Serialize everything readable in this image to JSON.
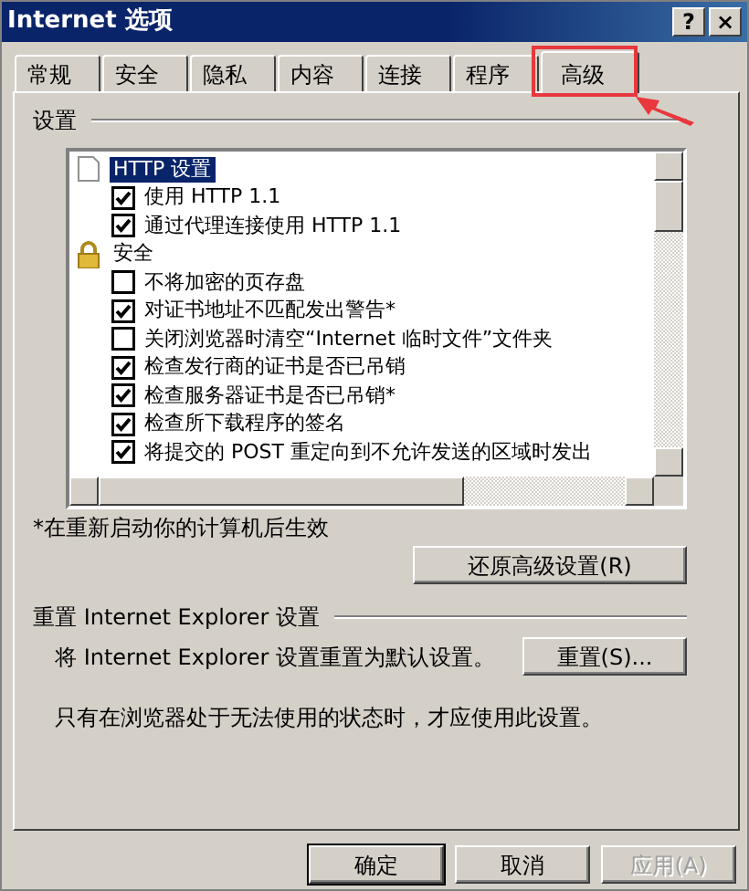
{
  "window": {
    "title": "Internet 选项",
    "buttons": [
      "?",
      "×"
    ]
  },
  "tabs": [
    {
      "label": "常规",
      "selected": false,
      "highlighted": false
    },
    {
      "label": "安全",
      "selected": false,
      "highlighted": false
    },
    {
      "label": "隐私",
      "selected": false,
      "highlighted": false
    },
    {
      "label": "内容",
      "selected": false,
      "highlighted": false
    },
    {
      "label": "连接",
      "selected": false,
      "highlighted": false
    },
    {
      "label": "程序",
      "selected": false,
      "highlighted": false
    },
    {
      "label": "高级",
      "selected": true,
      "highlighted": true
    }
  ],
  "settings": {
    "title": "设置",
    "categories": [
      {
        "label": "HTTP 设置",
        "kind": "document",
        "selected": true,
        "children": [
          {
            "label": "使用 HTTP 1.1",
            "checked": true
          },
          {
            "label": "通过代理连接使用 HTTP 1.1",
            "checked": true
          }
        ]
      },
      {
        "label": "安全",
        "kind": "lock",
        "selected": false,
        "children": [
          {
            "label": "不将加密的页存盘",
            "checked": false
          },
          {
            "label": "对证书地址不匹配发出警告*",
            "checked": true
          },
          {
            "label": "关闭浏览器时清空“Internet 临时文件”文件夹",
            "checked": false
          },
          {
            "label": "检查发行商的证书是否已吊销",
            "checked": true
          },
          {
            "label": "检查服务器证书是否已吊销*",
            "checked": true
          },
          {
            "label": "检查所下载程序的签名",
            "checked": true
          },
          {
            "label": "将提交的 POST 重定向到不允许发送的区域时发出",
            "checked": true
          }
        ]
      }
    ],
    "note": "*在重新启动你的计算机后生效",
    "restore_button": "还原高级设置(R)"
  },
  "reset": {
    "title": "重置 Internet Explorer 设置",
    "description": "将 Internet Explorer 设置重置为默认设置。",
    "button": "重置(S)...",
    "note": "只有在浏览器处于无法使用的状态时，才应使用此设置。"
  },
  "buttons": [
    {
      "label": "确定",
      "disabled": false,
      "default": true
    },
    {
      "label": "取消",
      "disabled": false,
      "default": false
    },
    {
      "label": "应用(A)",
      "disabled": true,
      "default": false
    }
  ]
}
